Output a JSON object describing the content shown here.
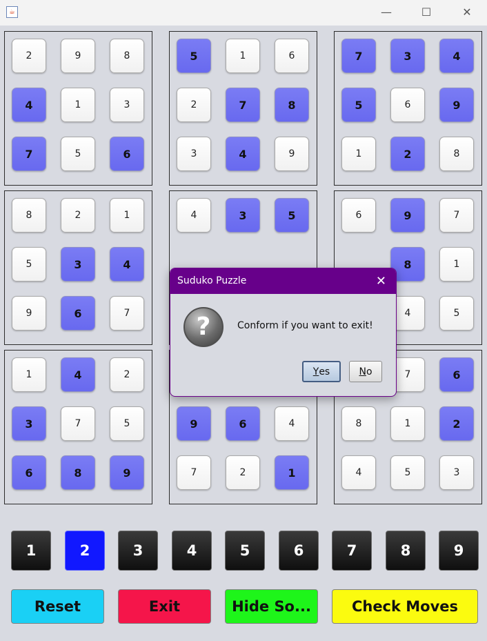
{
  "window": {
    "app_icon": "java-cup-icon",
    "controls": {
      "minimize": "—",
      "maximize": "☐",
      "close": "✕"
    }
  },
  "board": {
    "boxes": [
      {
        "cells": [
          {
            "v": "2",
            "t": "given"
          },
          {
            "v": "9",
            "t": "given"
          },
          {
            "v": "8",
            "t": "given"
          },
          {
            "v": "4",
            "t": "user"
          },
          {
            "v": "1",
            "t": "given"
          },
          {
            "v": "3",
            "t": "given"
          },
          {
            "v": "7",
            "t": "user"
          },
          {
            "v": "5",
            "t": "given"
          },
          {
            "v": "6",
            "t": "user"
          }
        ]
      },
      {
        "cells": [
          {
            "v": "5",
            "t": "user"
          },
          {
            "v": "1",
            "t": "given"
          },
          {
            "v": "6",
            "t": "given"
          },
          {
            "v": "2",
            "t": "given"
          },
          {
            "v": "7",
            "t": "user"
          },
          {
            "v": "8",
            "t": "user"
          },
          {
            "v": "3",
            "t": "given"
          },
          {
            "v": "4",
            "t": "user"
          },
          {
            "v": "9",
            "t": "given"
          }
        ]
      },
      {
        "cells": [
          {
            "v": "7",
            "t": "user"
          },
          {
            "v": "3",
            "t": "user"
          },
          {
            "v": "4",
            "t": "user"
          },
          {
            "v": "5",
            "t": "user"
          },
          {
            "v": "6",
            "t": "given"
          },
          {
            "v": "9",
            "t": "user"
          },
          {
            "v": "1",
            "t": "given"
          },
          {
            "v": "2",
            "t": "user"
          },
          {
            "v": "8",
            "t": "given"
          }
        ]
      },
      {
        "cells": [
          {
            "v": "8",
            "t": "given"
          },
          {
            "v": "2",
            "t": "given"
          },
          {
            "v": "1",
            "t": "given"
          },
          {
            "v": "5",
            "t": "given"
          },
          {
            "v": "3",
            "t": "user"
          },
          {
            "v": "4",
            "t": "user"
          },
          {
            "v": "9",
            "t": "given"
          },
          {
            "v": "6",
            "t": "user"
          },
          {
            "v": "7",
            "t": "given"
          }
        ]
      },
      {
        "cells": [
          {
            "v": "4",
            "t": "given"
          },
          {
            "v": "3",
            "t": "user"
          },
          {
            "v": "5",
            "t": "user"
          },
          {
            "v": "",
            "t": "covered"
          },
          {
            "v": "",
            "t": "covered"
          },
          {
            "v": "",
            "t": "covered"
          },
          {
            "v": "",
            "t": "covered"
          },
          {
            "v": "",
            "t": "covered"
          },
          {
            "v": "",
            "t": "covered"
          }
        ]
      },
      {
        "cells": [
          {
            "v": "6",
            "t": "given"
          },
          {
            "v": "9",
            "t": "user"
          },
          {
            "v": "7",
            "t": "given"
          },
          {
            "v": "",
            "t": "covered"
          },
          {
            "v": "8",
            "t": "user"
          },
          {
            "v": "1",
            "t": "given"
          },
          {
            "v": "",
            "t": "covered"
          },
          {
            "v": "4",
            "t": "given"
          },
          {
            "v": "5",
            "t": "given"
          }
        ]
      },
      {
        "cells": [
          {
            "v": "1",
            "t": "given"
          },
          {
            "v": "4",
            "t": "user"
          },
          {
            "v": "2",
            "t": "given"
          },
          {
            "v": "3",
            "t": "user"
          },
          {
            "v": "7",
            "t": "given"
          },
          {
            "v": "5",
            "t": "given"
          },
          {
            "v": "6",
            "t": "user"
          },
          {
            "v": "8",
            "t": "user"
          },
          {
            "v": "9",
            "t": "user"
          }
        ]
      },
      {
        "cells": [
          {
            "v": "",
            "t": "covered"
          },
          {
            "v": "",
            "t": "covered"
          },
          {
            "v": "",
            "t": "covered"
          },
          {
            "v": "9",
            "t": "user"
          },
          {
            "v": "6",
            "t": "user"
          },
          {
            "v": "4",
            "t": "given"
          },
          {
            "v": "7",
            "t": "given"
          },
          {
            "v": "2",
            "t": "given"
          },
          {
            "v": "1",
            "t": "user"
          }
        ]
      },
      {
        "cells": [
          {
            "v": "",
            "t": "covered"
          },
          {
            "v": "7",
            "t": "given"
          },
          {
            "v": "6",
            "t": "user"
          },
          {
            "v": "8",
            "t": "given"
          },
          {
            "v": "1",
            "t": "given"
          },
          {
            "v": "2",
            "t": "user"
          },
          {
            "v": "4",
            "t": "given"
          },
          {
            "v": "5",
            "t": "given"
          },
          {
            "v": "3",
            "t": "given"
          }
        ]
      }
    ]
  },
  "number_pad": {
    "buttons": [
      "1",
      "2",
      "3",
      "4",
      "5",
      "6",
      "7",
      "8",
      "9"
    ],
    "selected": "2"
  },
  "actions": {
    "reset": {
      "label": "Reset",
      "color": "#1ad0f5"
    },
    "exit": {
      "label": "Exit",
      "color": "#f5154a"
    },
    "hide_solution": {
      "label": "Hide So...",
      "color": "#1ef51a"
    },
    "check_moves": {
      "label": "Check Moves",
      "color": "#fbfb0f"
    }
  },
  "dialog": {
    "title": "Suduko Puzzle",
    "close": "✕",
    "icon": "question-icon",
    "icon_glyph": "?",
    "message": "Conform if you want to exit!",
    "yes": {
      "mnemonic": "Y",
      "rest": "es"
    },
    "no": {
      "mnemonic": "N",
      "rest": "o"
    }
  },
  "colors": {
    "background": "#d8dae1",
    "user_cell": "#6e70f2",
    "dialog_title": "#67008a",
    "selected_number": "#1118ff"
  }
}
